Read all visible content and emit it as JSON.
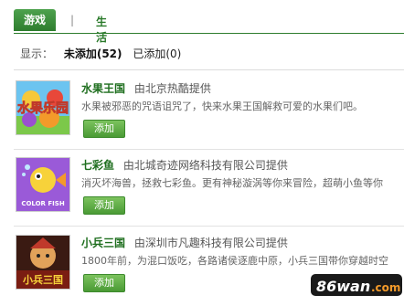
{
  "tabs": {
    "active": "游戏",
    "separator": "|",
    "other": "生活"
  },
  "filter": {
    "label": "显示：",
    "not_added": "未添加(52)",
    "added": "已添加(0)"
  },
  "games": [
    {
      "name": "水果王国",
      "provider": "由北京热酷提供",
      "desc": "水果被邪恶的咒语诅咒了，快来水果王国解救可爱的水果们吧。",
      "button": "添加",
      "thumb_label": "水果乐园"
    },
    {
      "name": "七彩鱼",
      "provider": "由北城奇迹网络科技有限公司提供",
      "desc": "消灭坏海兽，拯救七彩鱼。更有神秘漩涡等你来冒险，超萌小鱼等你",
      "button": "添加",
      "thumb_label": "COLOR FISH"
    },
    {
      "name": "小兵三国",
      "provider": "由深圳市凡趣科技有限公司提供",
      "desc": "1800年前，为混口饭吃，各路诸侯逐鹿中原，小兵三国带你穿越时空",
      "button": "添加",
      "thumb_label": "小兵三国"
    }
  ],
  "watermark": {
    "text": "86wan",
    "suffix": ".com"
  }
}
